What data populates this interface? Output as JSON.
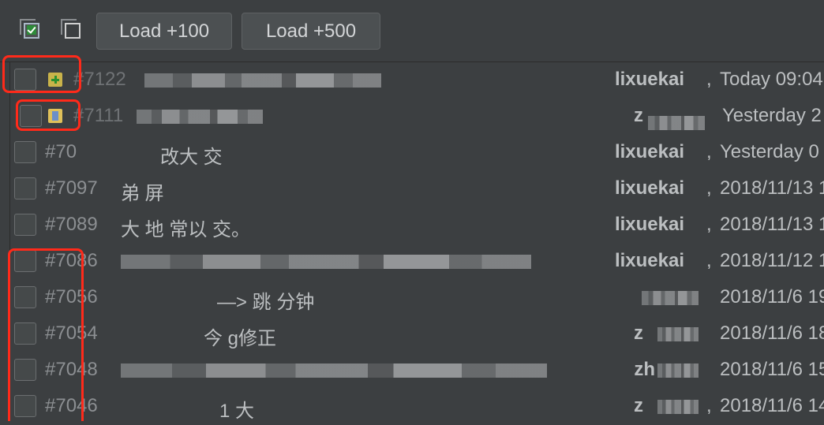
{
  "toolbar": {
    "select_all_icon": "checkbox-checked-icon",
    "deselect_all_icon": "checkbox-unchecked-icon",
    "load100_label": "Load +100",
    "load500_label": "Load +500"
  },
  "colors": {
    "background": "#3c3f41",
    "highlight": "#ff2a1a",
    "check_green": "#2e8b3a"
  },
  "rows": [
    {
      "number": "#7122",
      "status_icon": "added-icon",
      "desc_visible": "",
      "author": "lixuekai",
      "date": "Today 09:04"
    },
    {
      "number": "#7111",
      "status_icon": "modified-icon",
      "desc_visible": "",
      "author": "z",
      "date": "Yesterday 2"
    },
    {
      "number": "#70",
      "status_icon": "",
      "desc_visible": "改大  交",
      "author": "lixuekai",
      "date": "Yesterday 0"
    },
    {
      "number": "#7097",
      "status_icon": "",
      "desc_visible": "弟   屏",
      "author": "lixuekai",
      "date": "2018/11/13 1"
    },
    {
      "number": "#7089",
      "status_icon": "",
      "desc_visible": "大  地  常以  交。",
      "author": "lixuekai",
      "date": "2018/11/13 1"
    },
    {
      "number": "#7086",
      "status_icon": "",
      "desc_visible": "",
      "author": "lixuekai",
      "date": "2018/11/12 1"
    },
    {
      "number": "#7056",
      "status_icon": "",
      "desc_visible": "—> 跳  分钟",
      "author": "",
      "date": "2018/11/6 19"
    },
    {
      "number": "#7054",
      "status_icon": "",
      "desc_visible": "今  g修正",
      "author": "z",
      "date": "2018/11/6 18"
    },
    {
      "number": "#7048",
      "status_icon": "",
      "desc_visible": "",
      "author": "zh",
      "date": "2018/11/6 15"
    },
    {
      "number": "#7046",
      "status_icon": "",
      "desc_visible": "1 大",
      "author": "z",
      "date": "2018/11/6 14"
    }
  ]
}
